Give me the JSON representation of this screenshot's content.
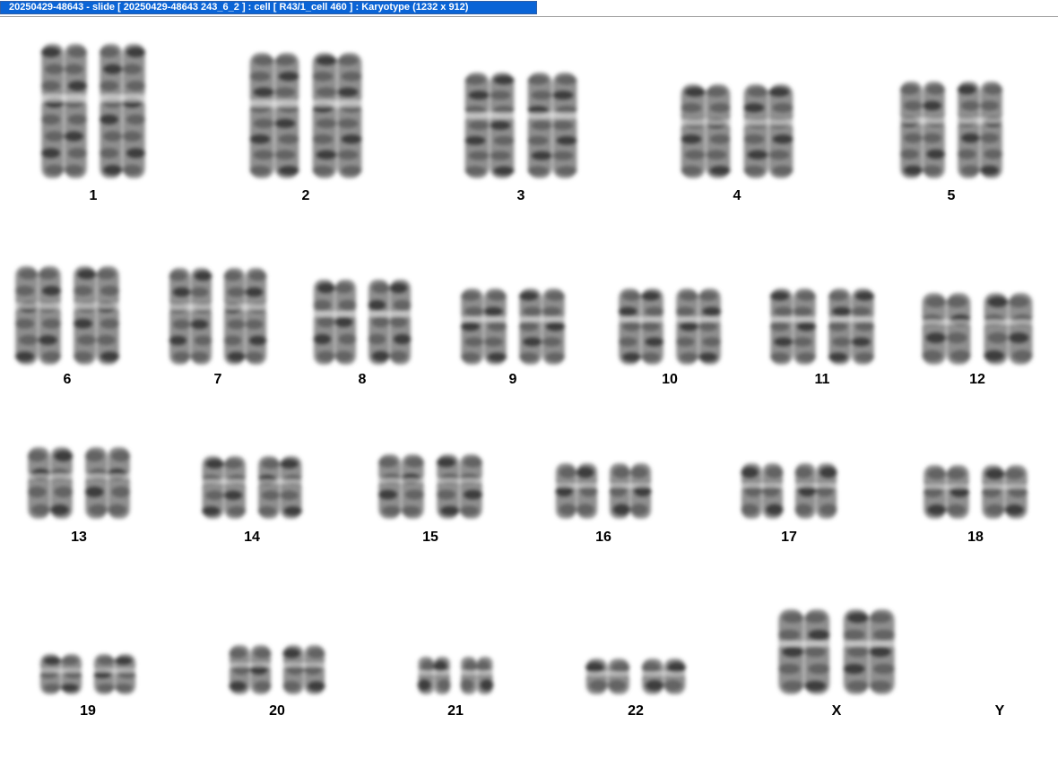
{
  "window": {
    "title": "20250429-48643 - slide [ 20250429-48643 243_6_2 ] : cell [ R43/1_cell 460 ] : Karyotype  (1232 x 912)"
  },
  "colors": {
    "title_bg": "#0a64d6",
    "title_text": "#ffffff",
    "chromosome": "#2f2f2f"
  },
  "karyotype": {
    "rows": [
      {
        "labels": [
          "1",
          "2",
          "3",
          "4",
          "5"
        ]
      },
      {
        "labels": [
          "6",
          "7",
          "8",
          "9",
          "10",
          "11",
          "12"
        ]
      },
      {
        "labels": [
          "13",
          "14",
          "15",
          "16",
          "17",
          "18"
        ]
      },
      {
        "labels": [
          "19",
          "20",
          "21",
          "22",
          "X",
          "Y"
        ]
      }
    ]
  }
}
